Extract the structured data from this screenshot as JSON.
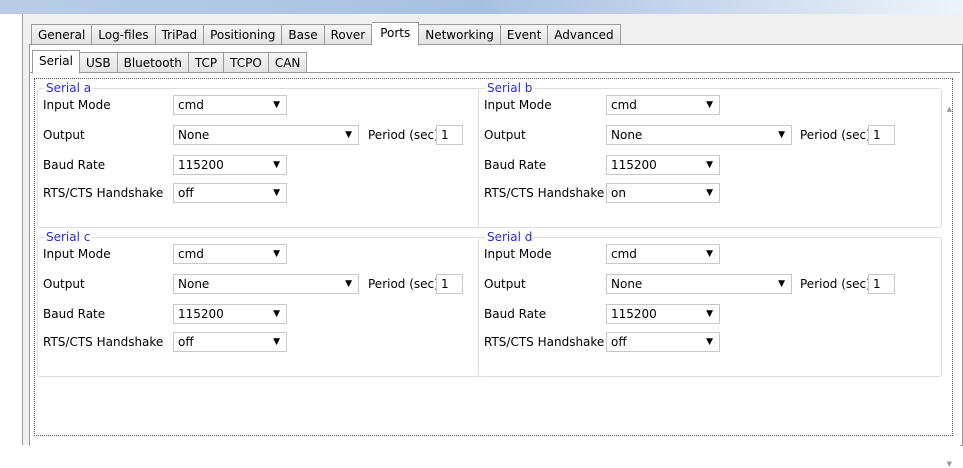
{
  "main_tabs": [
    "General",
    "Log-files",
    "TriPad",
    "Positioning",
    "Base",
    "Rover",
    "Ports",
    "Networking",
    "Event",
    "Advanced"
  ],
  "active_main_tab": "Ports",
  "sub_tabs": [
    "Serial",
    "USB",
    "Bluetooth",
    "TCP",
    "TCPO",
    "CAN"
  ],
  "active_sub_tab": "Serial",
  "labels": {
    "input_mode": "Input Mode",
    "output": "Output",
    "baud_rate": "Baud Rate",
    "handshake": "RTS/CTS Handshake",
    "period": "Period (sec):"
  },
  "groups": {
    "a": {
      "title": "Serial a",
      "input_mode": "cmd",
      "output": "None",
      "period": "1",
      "baud_rate": "115200",
      "handshake": "off"
    },
    "b": {
      "title": "Serial b",
      "input_mode": "cmd",
      "output": "None",
      "period": "1",
      "baud_rate": "115200",
      "handshake": "on"
    },
    "c": {
      "title": "Serial c",
      "input_mode": "cmd",
      "output": "None",
      "period": "1",
      "baud_rate": "115200",
      "handshake": "off"
    },
    "d": {
      "title": "Serial d",
      "input_mode": "cmd",
      "output": "None",
      "period": "1",
      "baud_rate": "115200",
      "handshake": "off"
    }
  },
  "icons": {
    "dropdown": "chevron-down-icon",
    "scroll_up": "scroll-up-icon",
    "scroll_down": "scroll-down-icon"
  }
}
